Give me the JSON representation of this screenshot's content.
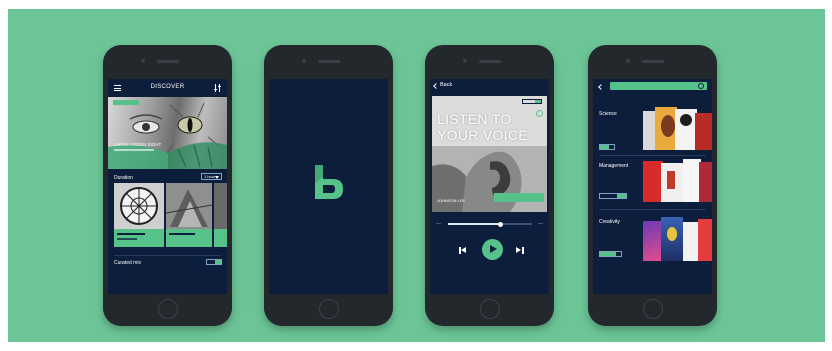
{
  "discover": {
    "title": "DISCOVER",
    "hero_caption": "JANOS GREEN SIGHT",
    "section_label": "Duration",
    "section_button": "1 hour",
    "bottom_label": "Curated mix"
  },
  "player": {
    "back_label": "Back",
    "headline_line1": "LISTEN TO",
    "headline_line2": "YOUR VOICE",
    "author": "JOHNSON LEE"
  },
  "categories": {
    "items": [
      {
        "label": "Science"
      },
      {
        "label": "Management"
      },
      {
        "label": "Creativity"
      }
    ]
  },
  "colors": {
    "background": "#6cc596",
    "screen": "#0c1e3c",
    "accent": "#57c18a"
  }
}
